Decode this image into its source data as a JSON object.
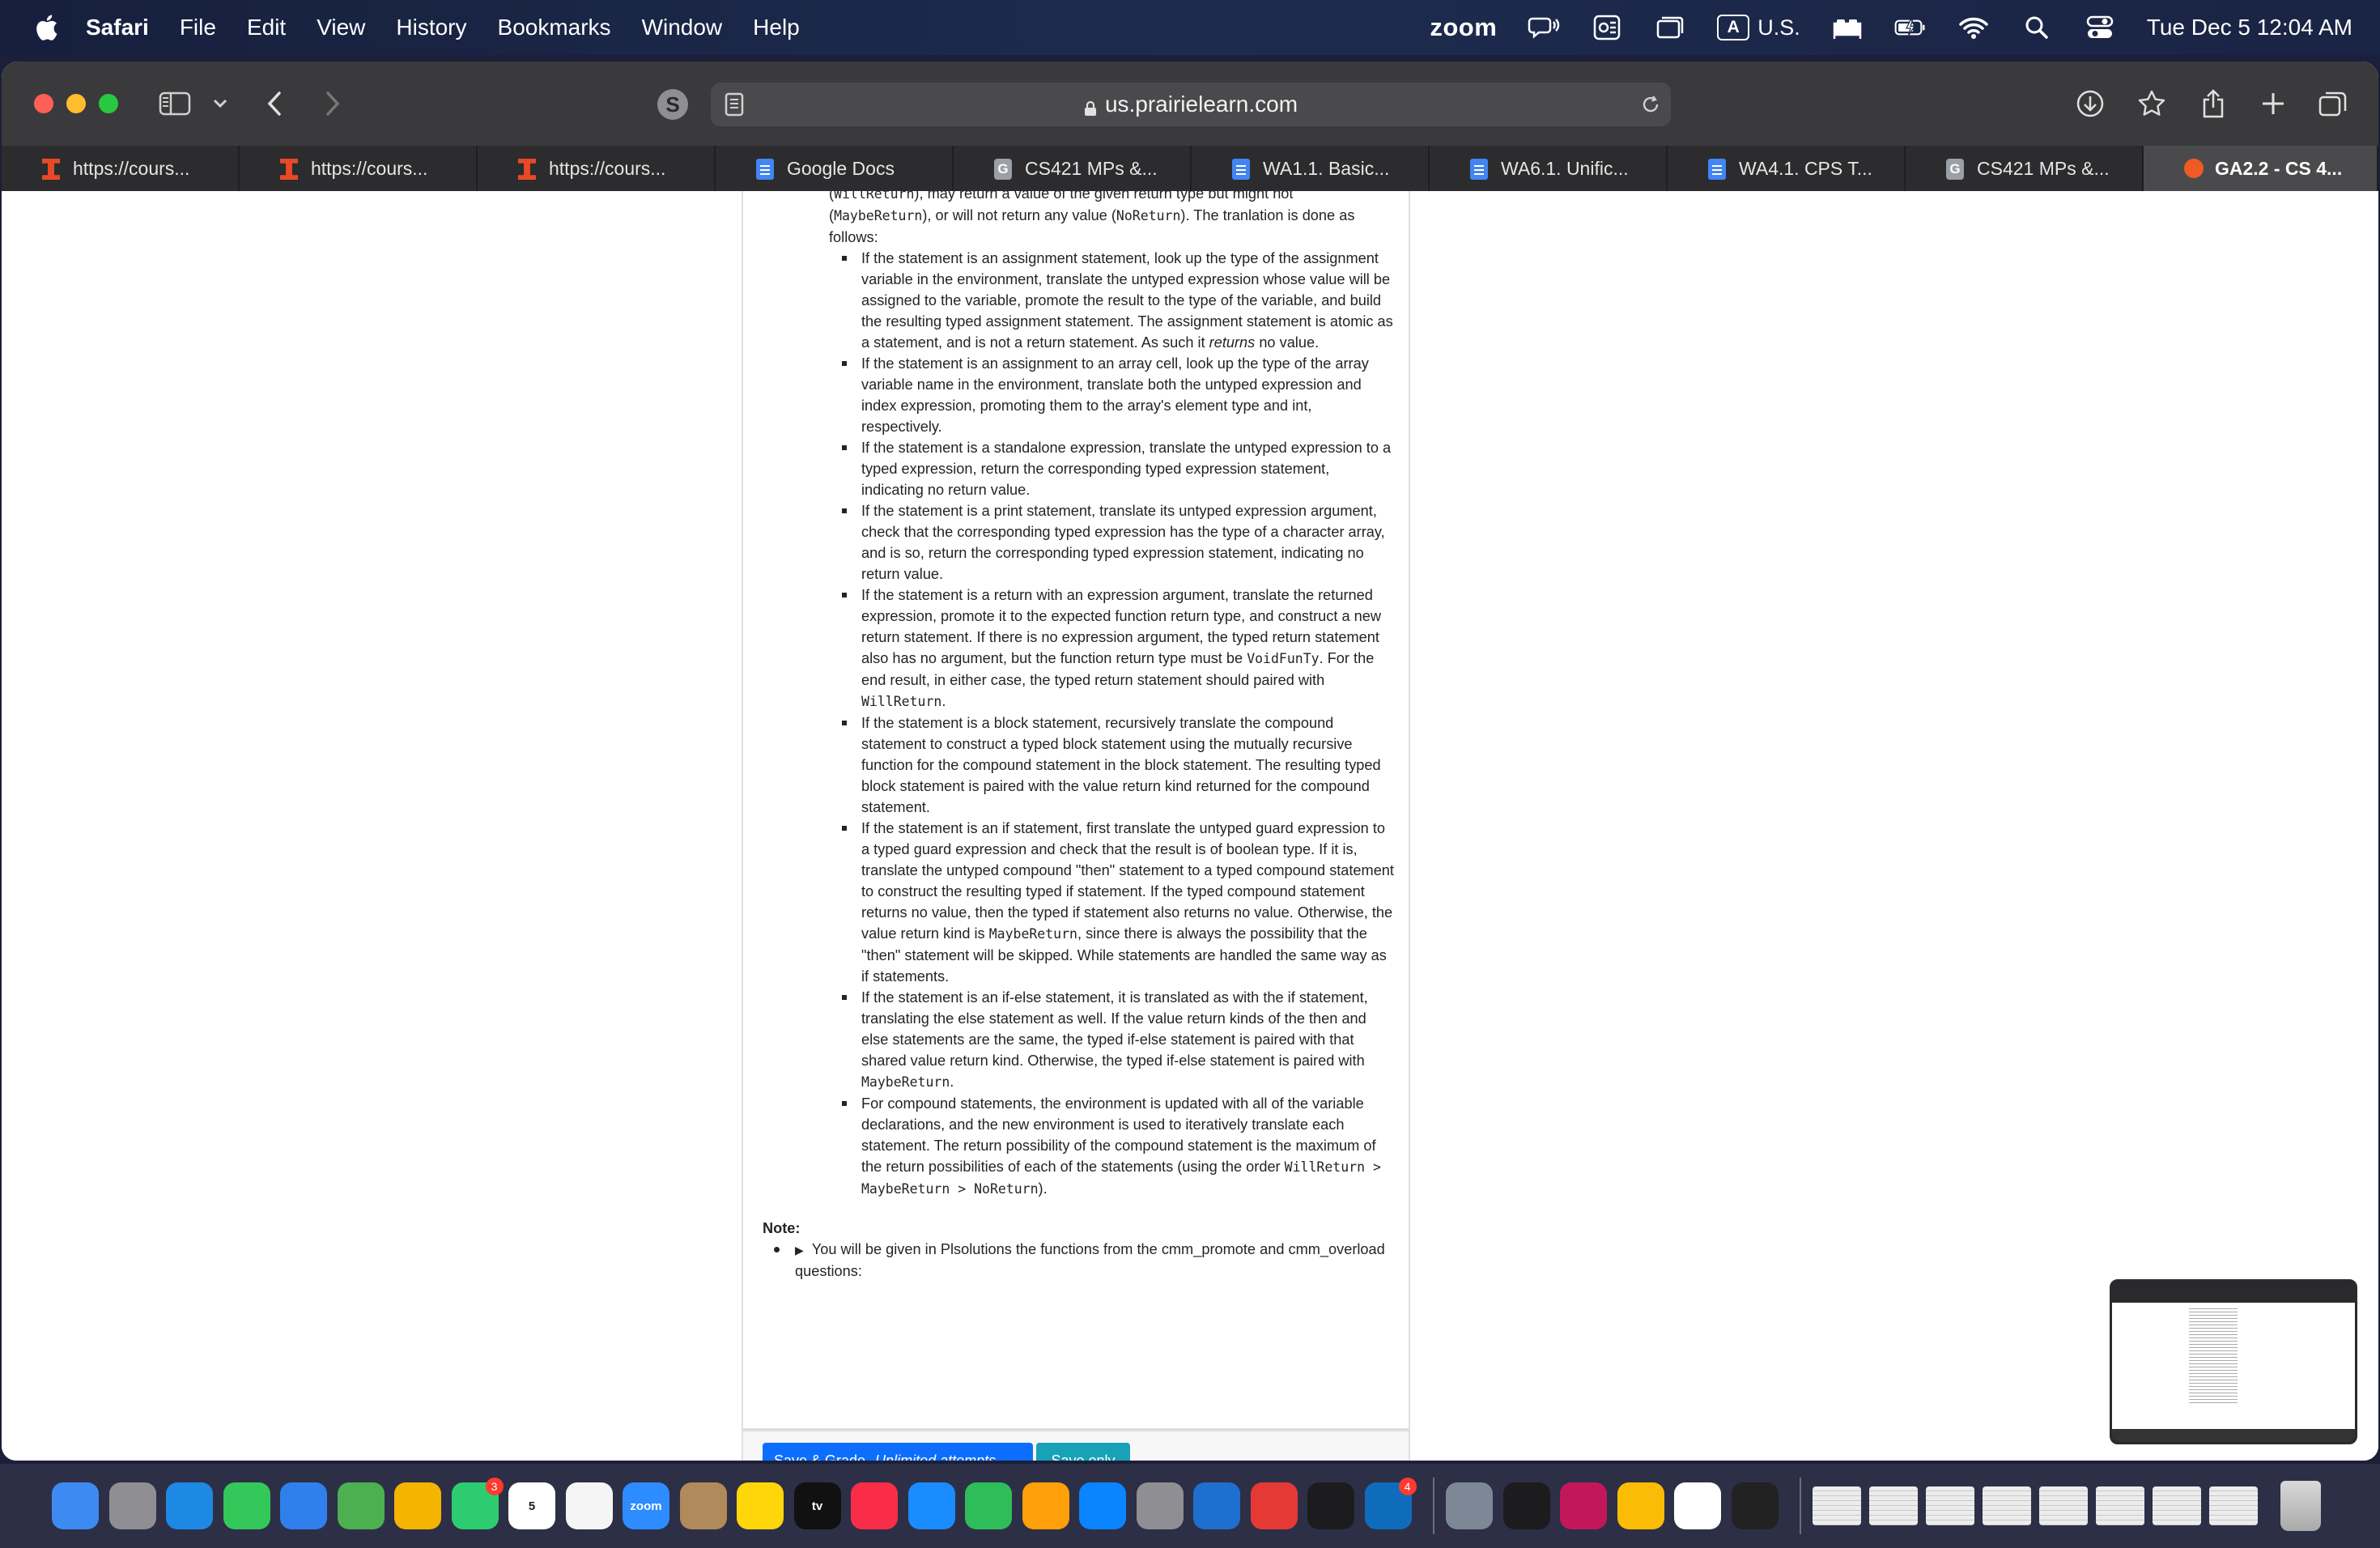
{
  "menubar": {
    "app_name": "Safari",
    "menus": [
      "File",
      "Edit",
      "View",
      "History",
      "Bookmarks",
      "Window",
      "Help"
    ],
    "status": {
      "zoom_label": "zoom",
      "input_source_box": "A",
      "input_source_label": "U.S.",
      "clock": "Tue Dec 5  12:04 AM"
    }
  },
  "safari": {
    "extension_letter": "S",
    "address": "us.prairielearn.com",
    "tabs": [
      {
        "label": "https://cours...",
        "icon": "illinois-favicon"
      },
      {
        "label": "https://cours...",
        "icon": "illinois-favicon"
      },
      {
        "label": "https://cours...",
        "icon": "illinois-favicon"
      },
      {
        "label": "Google Docs",
        "icon": "google-docs-favicon"
      },
      {
        "label": "CS421 MPs &...",
        "icon": "g-favicon"
      },
      {
        "label": "WA1.1. Basic...",
        "icon": "google-docs-favicon"
      },
      {
        "label": "WA6.1. Unific...",
        "icon": "google-docs-favicon"
      },
      {
        "label": "WA4.1. CPS T...",
        "icon": "google-docs-favicon"
      },
      {
        "label": "CS421 MPs &...",
        "icon": "g-favicon"
      },
      {
        "label": "GA2.2 - CS 4...",
        "icon": "prairielearn-favicon",
        "active": true
      }
    ]
  },
  "question": {
    "lead": {
      "code1": "WillReturn",
      "text1": "), may return a value of the given return type but might not (",
      "code2": "MaybeReturn",
      "text2": "), or will not return any value (",
      "code3": "NoReturn",
      "text3": "). The tranlation is done as follows:"
    },
    "rule_assign": {
      "text": "If the statement is an assignment statement, look up the type of the assignment variable in the environment, translate the untyped expression whose value will be assigned to the variable, promote the result to the type of the variable, and build the resulting typed assignment statement. The assignment statement is atomic as a statement, and is not a return statement. As such it ",
      "em": "returns",
      "tail": " no value."
    },
    "rule_array": "If the statement is an assignment to an array cell, look up the type of the array variable name in the environment, translate both the untyped expression and index expression, promoting them to the array's element type and int, respectively.",
    "rule_expr": "If the statement is a standalone expression, translate the untyped expression to a typed expression, return the corresponding typed expression statement, indicating no return value.",
    "rule_print": "If the statement is a print statement, translate its untyped expression argument, check that the corresponding typed expression has the type of a character array, and is so, return the corresponding typed expression statement, indicating no return value.",
    "rule_return": {
      "text": "If the statement is a return with an expression argument, translate the returned expression, promote it to the expected function return type, and construct a new return statement. If there is no expression argument, the typed return statement also has no argument, but the function return type must be ",
      "code1": "VoidFunTy",
      "text2": ". For the end result, in either case, the typed return statement should paired with ",
      "code2": "WillReturn",
      "tail": "."
    },
    "rule_block": "If the statement is a block statement, recursively translate the compound statement to construct a typed block statement using the mutually recursive function for the compound statement in the block statement. The resulting typed block statement is paired with the value return kind returned for the compound statement.",
    "rule_if": {
      "text": "If the statement is an if statement, first translate the untyped guard expression to a typed guard expression and check that the result is of boolean type. If it is, translate the untyped compound \"then\" statement to a typed compound statement to construct the resulting typed if statement. If the typed compound statement returns no value, then the typed if statement also returns no value. Otherwise, the value return kind is ",
      "code1": "MaybeReturn",
      "tail": ", since there is always the possibility that the \"then\" statement will be skipped. While statements are handled the same way as if statements."
    },
    "rule_ifelse": {
      "text": "If the statement is an if-else statement, it is translated as with the if statement, translating the else statement as well. If the value return kinds of the then and else statements are the same, the typed if-else statement is paired with that shared value return kind. Otherwise, the typed if-else statement is paired with ",
      "code1": "MaybeReturn",
      "tail": "."
    },
    "rule_compound": {
      "text": "For compound statements, the environment is updated with all of the variable declarations, and the new environment is used to iteratively translate each statement. The return possibility of the compound statement is the maximum of the return possibilities of each of the statements (using the order ",
      "code1": "WillReturn > MaybeReturn > NoReturn",
      "tail": ")."
    },
    "note_title": "Note:",
    "note_disclosure": "▶",
    "note_item": "You will be given in Plsolutions the functions from the cmm_promote and cmm_overload questions:"
  },
  "actions": {
    "save_grade_label": "Save & Grade",
    "save_grade_sub": "Unlimited attempts",
    "save_only_label": "Save only"
  },
  "dock": {
    "apps": [
      {
        "name": "finder",
        "color": "#3d8bf2"
      },
      {
        "name": "launchpad",
        "color": "#8e8e93"
      },
      {
        "name": "safari",
        "color": "#1e88e5"
      },
      {
        "name": "messages",
        "color": "#34c759"
      },
      {
        "name": "mail",
        "color": "#2f80ed"
      },
      {
        "name": "maps",
        "color": "#4caf50"
      },
      {
        "name": "photos",
        "color": "#f4b400"
      },
      {
        "name": "facetime",
        "color": "#2ecc71",
        "badge": "3"
      },
      {
        "name": "calendar",
        "color": "#ffffff",
        "label": "5"
      },
      {
        "name": "reminders",
        "color": "#f5f5f5"
      },
      {
        "name": "zoom",
        "color": "#2d8cff",
        "label": "zoom"
      },
      {
        "name": "contacts",
        "color": "#b08a5a"
      },
      {
        "name": "notes",
        "color": "#ffd60a"
      },
      {
        "name": "tv",
        "color": "#111111",
        "label": "tv"
      },
      {
        "name": "music",
        "color": "#fa2d48"
      },
      {
        "name": "keynote",
        "color": "#1a8cff"
      },
      {
        "name": "numbers",
        "color": "#2ebd59"
      },
      {
        "name": "pages",
        "color": "#ff9f0a"
      },
      {
        "name": "app-store",
        "color": "#0a84ff"
      },
      {
        "name": "system-settings",
        "color": "#8e8e93"
      },
      {
        "name": "vscode",
        "color": "#1f6fd1"
      },
      {
        "name": "speeko",
        "color": "#e53935"
      },
      {
        "name": "terminal-alt",
        "color": "#1c1c1e"
      },
      {
        "name": "outlook",
        "color": "#0f6cbd",
        "badge": "4"
      }
    ],
    "apps2": [
      {
        "name": "preview",
        "color": "#7d8896"
      },
      {
        "name": "terminal",
        "color": "#1c1c1e"
      },
      {
        "name": "intellij",
        "color": "#c2185b"
      },
      {
        "name": "chrome",
        "color": "#fbbc05"
      },
      {
        "name": "slack",
        "color": "#ffffff"
      },
      {
        "name": "activity-monitor",
        "color": "#222222"
      }
    ]
  }
}
